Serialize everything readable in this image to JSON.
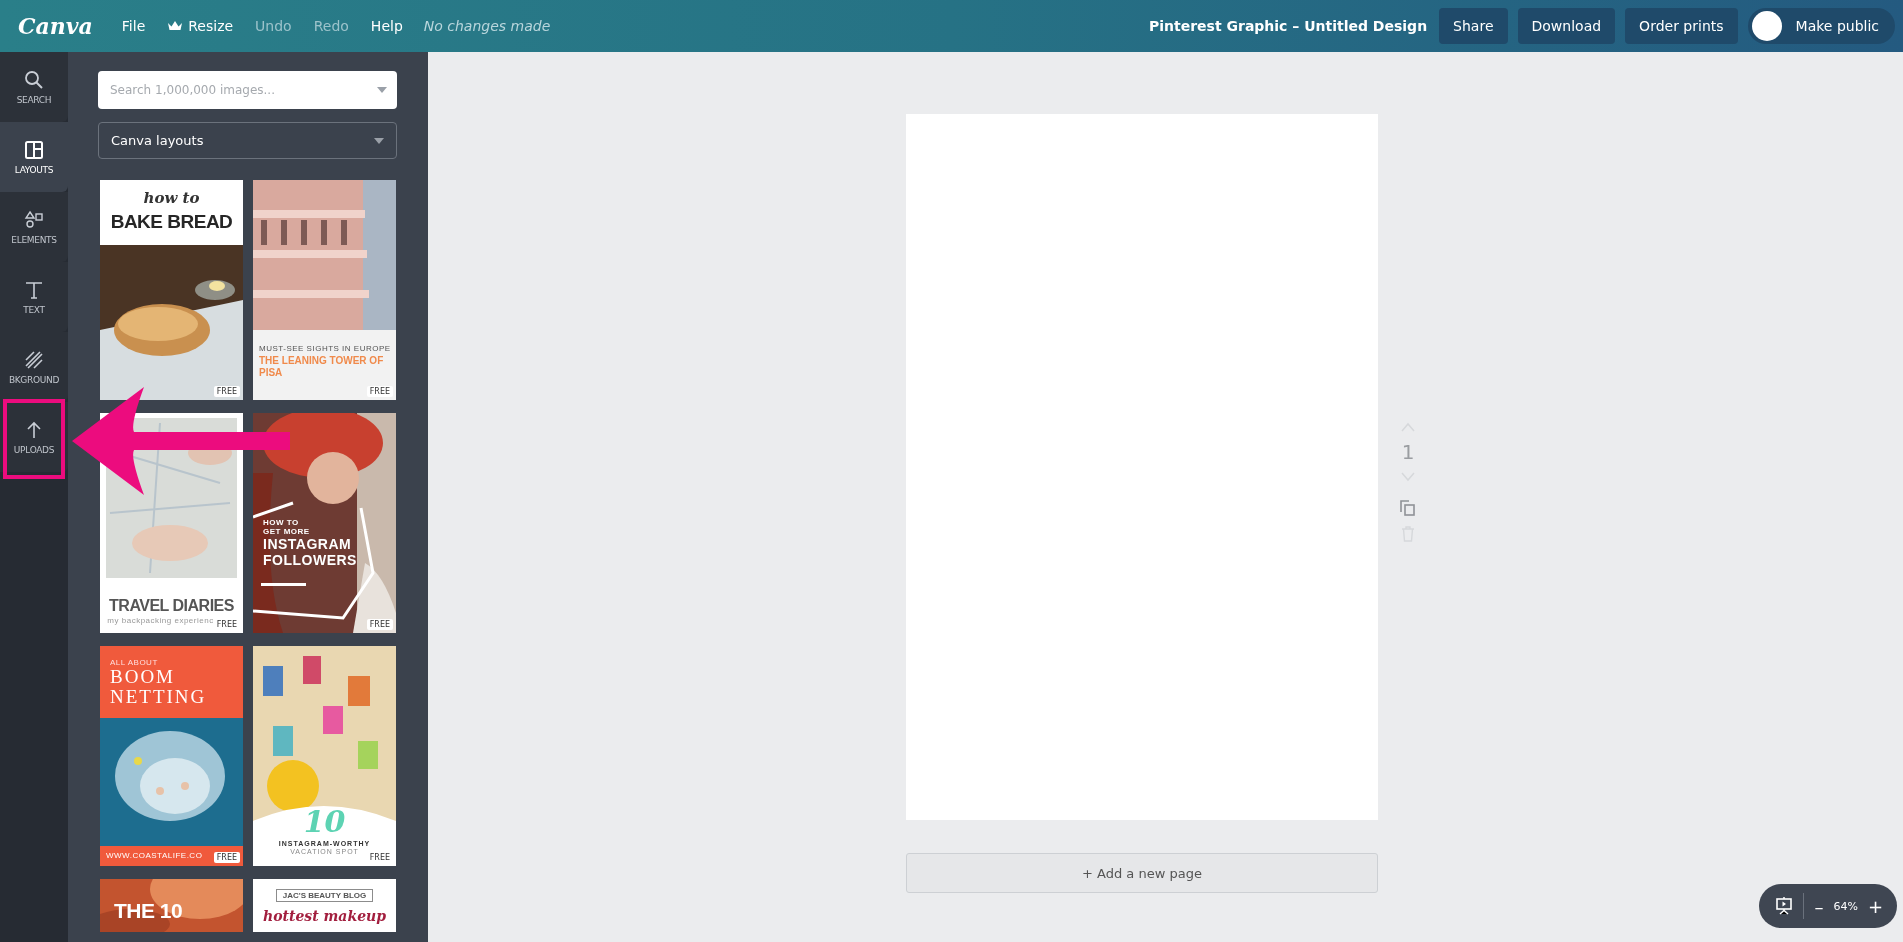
{
  "topbar": {
    "logo": "Canva",
    "menu": [
      {
        "label": "File",
        "disabled": false
      },
      {
        "label": "Resize",
        "disabled": false,
        "kind": "crown"
      },
      {
        "label": "Undo",
        "disabled": true
      },
      {
        "label": "Redo",
        "disabled": true
      },
      {
        "label": "Help",
        "disabled": false
      }
    ],
    "status": "No changes made",
    "design_title": "Pinterest Graphic – Untitled Design",
    "buttons": [
      "Share",
      "Download",
      "Order prints"
    ],
    "public_toggle": {
      "label": "Make public",
      "on": false
    }
  },
  "rail": [
    {
      "label": "SEARCH",
      "selected": false,
      "highlighted": false
    },
    {
      "label": "LAYOUTS",
      "selected": true,
      "highlighted": false
    },
    {
      "label": "ELEMENTS",
      "selected": false,
      "highlighted": false
    },
    {
      "label": "TEXT",
      "selected": false,
      "highlighted": false
    },
    {
      "label": "BKGROUND",
      "selected": false,
      "highlighted": false
    },
    {
      "label": "UPLOADS",
      "selected": false,
      "highlighted": true
    }
  ],
  "panel": {
    "search": {
      "placeholder": "Search 1,000,000 images..."
    },
    "source": {
      "value": "Canva layouts"
    },
    "templates": [
      {
        "kind": "bread",
        "badge": "FREE",
        "texts": [
          {
            "text": "how to",
            "kind": "script"
          },
          {
            "text": "BAKE BREAD",
            "kind": "headline"
          }
        ]
      },
      {
        "kind": "tower",
        "badge": "FREE",
        "texts": [
          {
            "text": "MUST-SEE SIGHTS IN EUROPE",
            "kind": "small"
          },
          {
            "text": "THE LEANING TOWER OF PISA",
            "kind": "accent"
          }
        ]
      },
      {
        "kind": "map",
        "badge": "FREE",
        "texts": [
          {
            "text": "TRAVEL DIARIES",
            "kind": "headline"
          },
          {
            "text": "my backpacking experienc",
            "kind": "small"
          }
        ]
      },
      {
        "kind": "portrait",
        "badge": "FREE",
        "texts": [
          {
            "text": "HOW TO",
            "kind": "small"
          },
          {
            "text": "GET MORE",
            "kind": "small"
          },
          {
            "text": "INSTAGRAM FOLLOWERS",
            "kind": "headline"
          }
        ]
      },
      {
        "kind": "sea",
        "badge": "FREE",
        "texts": [
          {
            "text": "ALL ABOUT",
            "kind": "small"
          },
          {
            "text": "BOOM NETTING",
            "kind": "serif"
          },
          {
            "text": "WWW.COASTALIFE.CO",
            "kind": "footer"
          }
        ]
      },
      {
        "kind": "beach",
        "badge": "FREE",
        "texts": [
          {
            "text": "10",
            "kind": "number"
          },
          {
            "text": "INSTAGRAM-WORTHY",
            "kind": "small"
          },
          {
            "text": "VACATION SPOT",
            "kind": "small"
          }
        ]
      },
      {
        "kind": "flower",
        "texts": [
          {
            "text": "THE 10",
            "kind": "headline"
          }
        ]
      },
      {
        "kind": "plain",
        "texts": [
          {
            "text": "JAC'S BEAUTY BLOG",
            "kind": "tag"
          },
          {
            "text": "hottest makeup",
            "kind": "script"
          }
        ]
      }
    ]
  },
  "page_controls": {
    "page_number": "1"
  },
  "add_page": "+ Add a new page",
  "zoom": {
    "minus": "–",
    "value": "64%",
    "plus": "+"
  }
}
